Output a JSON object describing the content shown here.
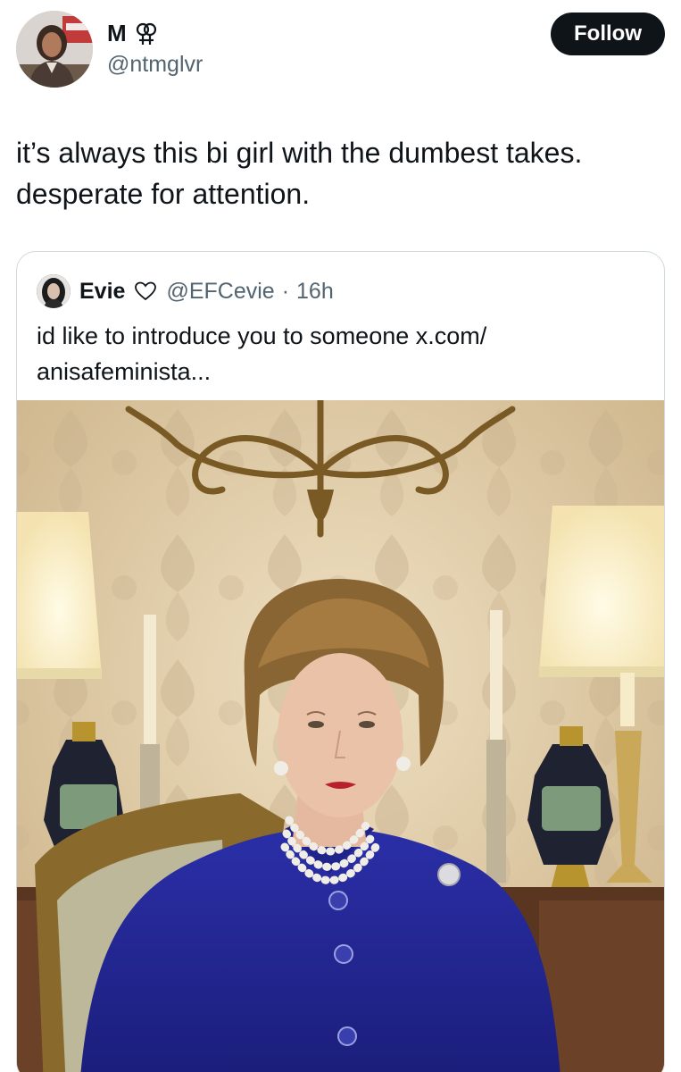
{
  "tweet": {
    "author": {
      "display_name": "M",
      "handle": "@ntmglvr",
      "avatar_icon": "avatar-photo",
      "badge_icon": "double-venus-icon"
    },
    "follow_label": "Follow",
    "text_line1": "it’s always this bi girl with the dumbest takes.",
    "text_line2": "desperate for attention."
  },
  "quoted": {
    "display_name": "Evie",
    "badge_icon": "heart-outline-icon",
    "handle": "@EFCevie",
    "separator": "·",
    "time": "16h",
    "text_line1": "id like to introduce you to someone x.com/",
    "text_line2": "anisafeminista...",
    "media_icon": "portrait-photo"
  },
  "colors": {
    "text_primary": "#0f1419",
    "text_secondary": "#536471",
    "follow_bg": "#0f1419",
    "card_border": "#cfd9de"
  }
}
